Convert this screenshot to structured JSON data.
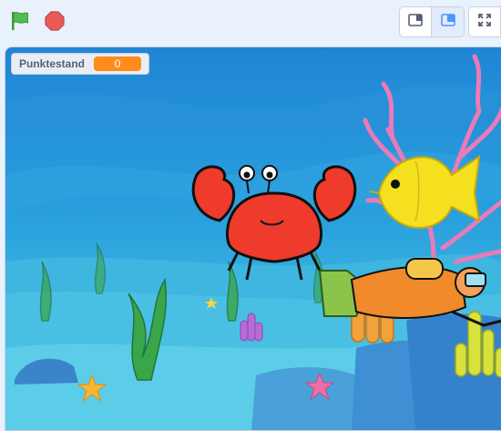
{
  "toolbar": {
    "green_flag_icon": "green-flag-icon",
    "stop_icon": "stop-icon",
    "small_stage_icon": "small-stage-icon",
    "large_stage_icon": "large-stage-icon",
    "fullscreen_icon": "fullscreen-icon"
  },
  "monitor": {
    "label": "Punktestand",
    "value": "0"
  },
  "colors": {
    "flag": "#4cbf56",
    "stop": "#ec5959",
    "monitor_value_bg": "#ff8c1a",
    "water_top": "#1e7fd0",
    "water_bottom": "#4fc0e8"
  },
  "sprites": [
    "crab",
    "yellow-fish",
    "diver"
  ]
}
